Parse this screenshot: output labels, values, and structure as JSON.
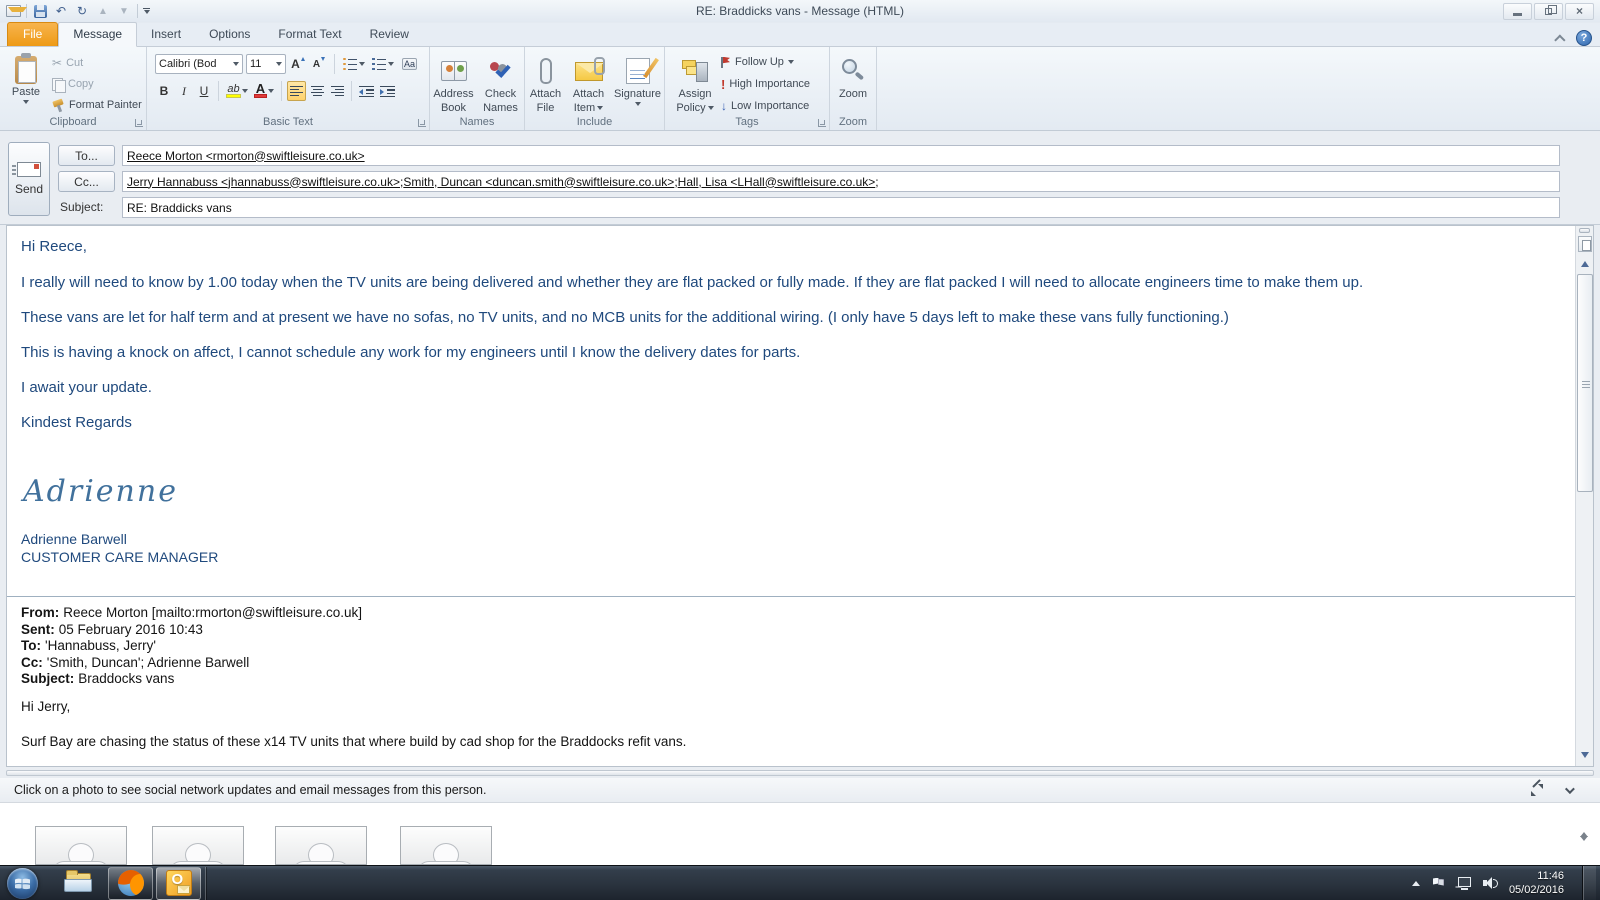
{
  "titlebar": {
    "title": "RE: Braddicks vans  -  Message (HTML)"
  },
  "icons": {
    "undo": "↶",
    "redo": "↻",
    "up_arrow": "▲",
    "down_arrow": "▼",
    "close": "×",
    "help": "?",
    "scissors": "✂",
    "high_importance_glyph": "!",
    "low_importance_glyph": "↓"
  },
  "tabs": {
    "file": "File",
    "message": "Message",
    "insert": "Insert",
    "options": "Options",
    "format_text": "Format Text",
    "review": "Review"
  },
  "ribbon": {
    "clipboard": {
      "label": "Clipboard",
      "paste": "Paste",
      "cut": "Cut",
      "copy": "Copy",
      "format_painter": "Format Painter"
    },
    "basic_text": {
      "label": "Basic Text",
      "font_name": "Calibri (Bod",
      "font_size": "11",
      "bold": "B",
      "italic": "I",
      "underline": "U",
      "grow": "A",
      "shrink": "A",
      "highlight": "ab",
      "font_color": "A",
      "clear": "Aa"
    },
    "names": {
      "label": "Names",
      "address_1": "Address",
      "address_2": "Book",
      "check_1": "Check",
      "check_2": "Names"
    },
    "include": {
      "label": "Include",
      "attach_file_1": "Attach",
      "attach_file_2": "File",
      "attach_item_1": "Attach",
      "attach_item_2": "Item",
      "signature": "Signature"
    },
    "tags": {
      "label": "Tags",
      "assign_1": "Assign",
      "assign_2": "Policy",
      "follow_up": "Follow Up",
      "high_importance": "High Importance",
      "low_importance": "Low Importance"
    },
    "zoom": {
      "label": "Zoom",
      "zoom": "Zoom"
    }
  },
  "envelope": {
    "send": "Send",
    "to_button": "To...",
    "cc_button": "Cc...",
    "subject_label": "Subject:",
    "to_value": "Reece Morton <rmorton@swiftleisure.co.uk>",
    "cc": [
      {
        "text": "Jerry Hannabuss <jhannabuss@swiftleisure.co.uk>",
        "sep": "; "
      },
      {
        "text": "Smith, Duncan <duncan.smith@swiftleisure.co.uk>",
        "sep": "; "
      },
      {
        "text": "Hall, Lisa <LHall@swiftleisure.co.uk>",
        "sep": ";"
      }
    ],
    "subject_value": "RE: Braddicks vans"
  },
  "body": {
    "paragraphs": [
      "Hi Reece,",
      "I really will need to know by 1.00 today when the TV units are being delivered and whether they are flat packed or fully made.  If they are flat packed I will need to allocate engineers time to make them up.",
      "These vans are let for half term and at present we have no sofas, no TV units, and no MCB units for the additional wiring.  (I only have 5 days left to make these vans fully functioning.)",
      "This is having a knock on affect, I cannot schedule any work for my engineers until I know the delivery dates for parts.",
      "I await your update.",
      "Kindest Regards"
    ],
    "signature_script": "Adrienne",
    "signature_name": "Adrienne Barwell",
    "signature_title": "CUSTOMER CARE MANAGER",
    "quoted": {
      "from_label": "From:",
      "from_value": "Reece Morton [mailto:rmorton@swiftleisure.co.uk]",
      "sent_label": "Sent:",
      "sent_value": "05 February 2016 10:43",
      "to_label": "To:",
      "to_value": "'Hannabuss, Jerry'",
      "cc_label": "Cc:",
      "cc_value": "'Smith, Duncan'; Adrienne Barwell",
      "subject_label": "Subject:",
      "subject_value": "Braddocks vans",
      "greeting": "Hi Jerry,",
      "line1": "Surf Bay are chasing the status of these x14 TV units that where build by cad shop for the Braddocks refit vans."
    }
  },
  "people_pane": {
    "hint": "Click on a photo to see social network updates and email messages from this person."
  },
  "taskbar": {
    "time": "11:46",
    "date": "05/02/2016"
  },
  "colors": {
    "file_tab_orange": "#ee9a16",
    "body_text_blue": "#1f497d",
    "selection_orange": "#ffd26b"
  }
}
